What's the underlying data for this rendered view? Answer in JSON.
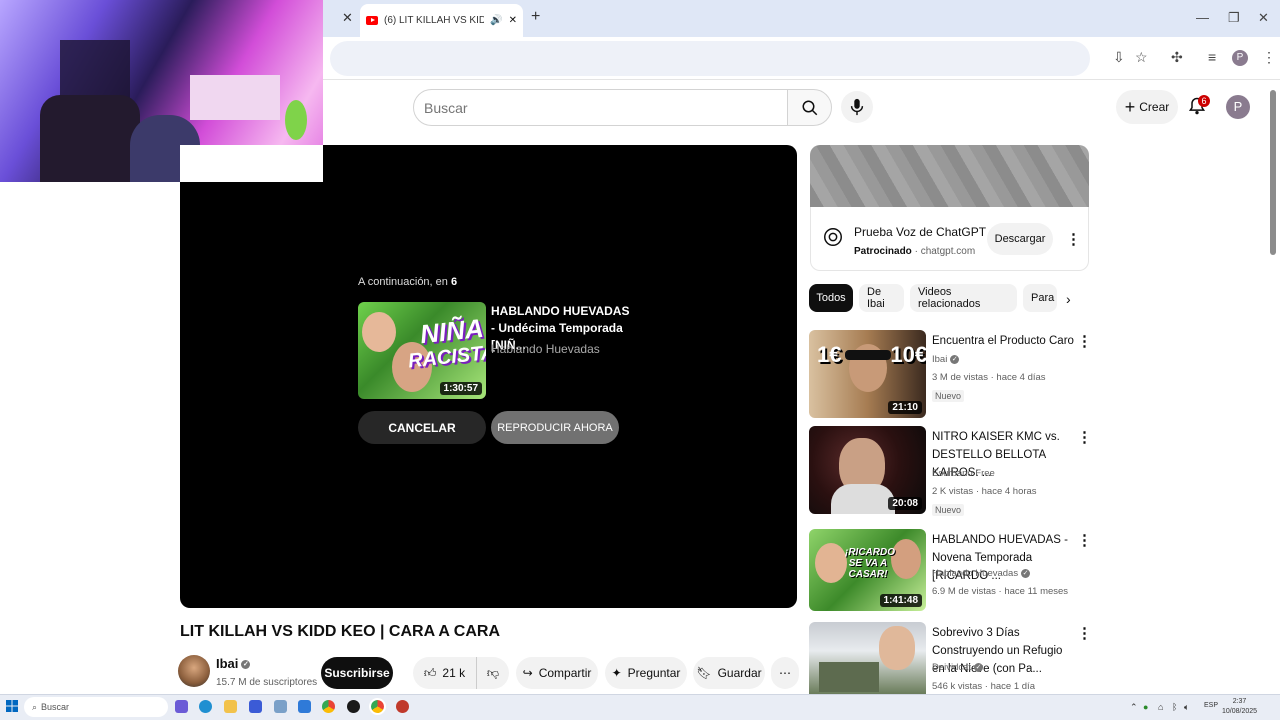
{
  "browser": {
    "tab_title": "(6) LIT KILLAH VS KIDD KEO | CARA A CARA",
    "tab_close": "✕",
    "new_tab": "+",
    "profile_letter": "P"
  },
  "youtube": {
    "search_placeholder": "Buscar",
    "create_label": "Crear",
    "notif_count": "6",
    "avatar_letter": "P"
  },
  "player": {
    "upnext_prefix": "A continuación, en",
    "upnext_seconds": "6",
    "next_title": "HABLANDO HUEVADAS - Undécima Temporada [NIÑ...",
    "next_channel": "Hablando Huevadas",
    "next_duration": "1:30:57",
    "next_thumb_text1": "NIÑA",
    "next_thumb_text2": "RACISTA",
    "cancel_label": "CANCELAR",
    "play_now_label": "REPRODUCIR AHORA"
  },
  "video": {
    "title": "LIT KILLAH VS KIDD KEO | CARA A CARA",
    "channel": "Ibai",
    "subscribers": "15.7 M de suscriptores",
    "subscribe_label": "Suscribirse",
    "likes": "21 k",
    "share_label": "Compartir",
    "ask_label": "Preguntar",
    "save_label": "Guardar"
  },
  "ad": {
    "title": "Prueba Voz de ChatGPT",
    "sponsored": "Patrocinado",
    "domain": "chatgpt.com",
    "button": "Descargar"
  },
  "chips": [
    "Todos",
    "De Ibai",
    "Videos relacionados",
    "Para"
  ],
  "recommendations": [
    {
      "title": "Encuentra el Producto Caro",
      "channel": "Ibai",
      "verified": true,
      "meta": "3 M de vistas · hace 4 días",
      "badge": "Nuevo",
      "duration": "21:10",
      "thumb_text": "1€        10€"
    },
    {
      "title": "NITRO KAISER KMC vs. DESTELLO BELLOTA KAIROS: ...",
      "channel": "Esurbano Free",
      "verified": false,
      "meta": "2 K vistas · hace 4 horas",
      "badge": "Nuevo",
      "duration": "20:08",
      "thumb_text": ""
    },
    {
      "title": "HABLANDO HUEVADAS - Novena Temporada [RICARDO ...",
      "channel": "Hablando Huevadas",
      "verified": true,
      "meta": "6.9 M de vistas · hace 11 meses",
      "badge": "",
      "duration": "1:41:48",
      "thumb_text": "¡RICARDO SE VA A CASAR!"
    },
    {
      "title": "Sobrevivo 3 Días Construyendo un Refugio en la Nieve (con Pa...",
      "channel": "Deividcat",
      "verified": true,
      "meta": "546 k vistas · hace 1 día",
      "badge": "",
      "duration": "",
      "thumb_text": ""
    }
  ],
  "taskbar": {
    "search_placeholder": "Buscar",
    "lang": "ESP",
    "time": "2:37",
    "date": "10/08/2025"
  }
}
